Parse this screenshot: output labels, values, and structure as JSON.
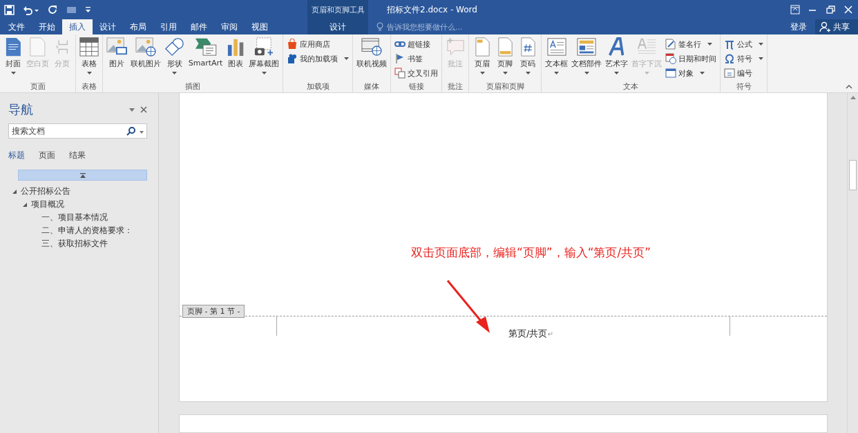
{
  "title_bar": {
    "title": "招标文件2.docx - Word"
  },
  "tabs": [
    {
      "label": "文件",
      "selected": false
    },
    {
      "label": "开始",
      "selected": false
    },
    {
      "label": "插入",
      "selected": true
    },
    {
      "label": "设计",
      "selected": false
    },
    {
      "label": "布局",
      "selected": false
    },
    {
      "label": "引用",
      "selected": false
    },
    {
      "label": "邮件",
      "selected": false
    },
    {
      "label": "审阅",
      "selected": false
    },
    {
      "label": "视图",
      "selected": false
    }
  ],
  "contextual_tabs": {
    "title": "页眉和页脚工具",
    "tabs": [
      {
        "label": "设计",
        "selected": false
      }
    ]
  },
  "tell_me": {
    "placeholder": "告诉我您想要做什么..."
  },
  "account": {
    "sign_in": "登录",
    "share": "共享"
  },
  "ribbon": {
    "groups": [
      {
        "name": "页面",
        "items": [
          {
            "label": "封面",
            "kind": "large",
            "dropdown": true,
            "disabled": false
          },
          {
            "label": "空白页",
            "kind": "large",
            "dropdown": false,
            "disabled": true
          },
          {
            "label": "分页",
            "kind": "large",
            "dropdown": false,
            "disabled": true
          }
        ]
      },
      {
        "name": "表格",
        "items": [
          {
            "label": "表格",
            "kind": "large",
            "dropdown": true,
            "disabled": false
          }
        ]
      },
      {
        "name": "插图",
        "items": [
          {
            "label": "图片",
            "kind": "large",
            "dropdown": false,
            "disabled": false
          },
          {
            "label": "联机图片",
            "kind": "large",
            "dropdown": false,
            "disabled": false
          },
          {
            "label": "形状",
            "kind": "large",
            "dropdown": true,
            "disabled": false
          },
          {
            "label": "SmartArt",
            "kind": "large",
            "dropdown": false,
            "disabled": false
          },
          {
            "label": "图表",
            "kind": "large",
            "dropdown": false,
            "disabled": false
          },
          {
            "label": "屏幕截图",
            "kind": "large",
            "dropdown": true,
            "disabled": false
          }
        ]
      },
      {
        "name": "加载项",
        "items": [
          {
            "label": "应用商店",
            "kind": "small",
            "dropdown": false,
            "disabled": false
          },
          {
            "label": "我的加载项",
            "kind": "small",
            "dropdown": true,
            "disabled": false
          }
        ]
      },
      {
        "name": "媒体",
        "items": [
          {
            "label": "联机视频",
            "kind": "large",
            "dropdown": false,
            "disabled": false
          }
        ]
      },
      {
        "name": "链接",
        "items": [
          {
            "label": "超链接",
            "kind": "small",
            "dropdown": false,
            "disabled": false
          },
          {
            "label": "书签",
            "kind": "small",
            "dropdown": false,
            "disabled": false
          },
          {
            "label": "交叉引用",
            "kind": "small",
            "dropdown": false,
            "disabled": false
          }
        ]
      },
      {
        "name": "批注",
        "items": [
          {
            "label": "批注",
            "kind": "large",
            "dropdown": false,
            "disabled": true
          }
        ]
      },
      {
        "name": "页眉和页脚",
        "items": [
          {
            "label": "页眉",
            "kind": "large",
            "dropdown": true,
            "disabled": false
          },
          {
            "label": "页脚",
            "kind": "large",
            "dropdown": true,
            "disabled": false
          },
          {
            "label": "页码",
            "kind": "large",
            "dropdown": true,
            "disabled": false
          }
        ]
      },
      {
        "name": "文本",
        "items": [
          {
            "label": "文本框",
            "kind": "large",
            "dropdown": true,
            "disabled": false
          },
          {
            "label": "文档部件",
            "kind": "large",
            "dropdown": true,
            "disabled": false
          },
          {
            "label": "艺术字",
            "kind": "large",
            "dropdown": true,
            "disabled": false
          },
          {
            "label": "首字下沉",
            "kind": "large",
            "dropdown": true,
            "disabled": true
          },
          {
            "label": "签名行",
            "kind": "small",
            "dropdown": true,
            "disabled": false
          },
          {
            "label": "日期和时间",
            "kind": "small",
            "dropdown": false,
            "disabled": false
          },
          {
            "label": "对象",
            "kind": "small",
            "dropdown": true,
            "disabled": false
          }
        ]
      },
      {
        "name": "符号",
        "items": [
          {
            "label": "公式",
            "kind": "small",
            "dropdown": true,
            "disabled": false
          },
          {
            "label": "符号",
            "kind": "small",
            "dropdown": true,
            "disabled": false
          },
          {
            "label": "编号",
            "kind": "small",
            "dropdown": false,
            "disabled": false
          }
        ]
      }
    ]
  },
  "navigation": {
    "title": "导航",
    "search": {
      "placeholder": "搜索文档"
    },
    "tabs": [
      {
        "label": "标题",
        "selected": true
      },
      {
        "label": "页面",
        "selected": false
      },
      {
        "label": "结果",
        "selected": false
      }
    ],
    "tree": [
      {
        "label": "公开招标公告",
        "expanded": true,
        "children": [
          {
            "label": "项目概况",
            "expanded": true,
            "children": [
              {
                "label": "一、项目基本情况"
              },
              {
                "label": "二、申请人的资格要求："
              },
              {
                "label": "三、获取招标文件"
              }
            ]
          }
        ]
      }
    ]
  },
  "document": {
    "annotation": "双击页面底部，编辑“页脚”，输入“第页/共页”",
    "footer_tag": "页脚 - 第 1 节 -",
    "footer_text": "第页/共页",
    "paragraph_mark": "↵"
  }
}
